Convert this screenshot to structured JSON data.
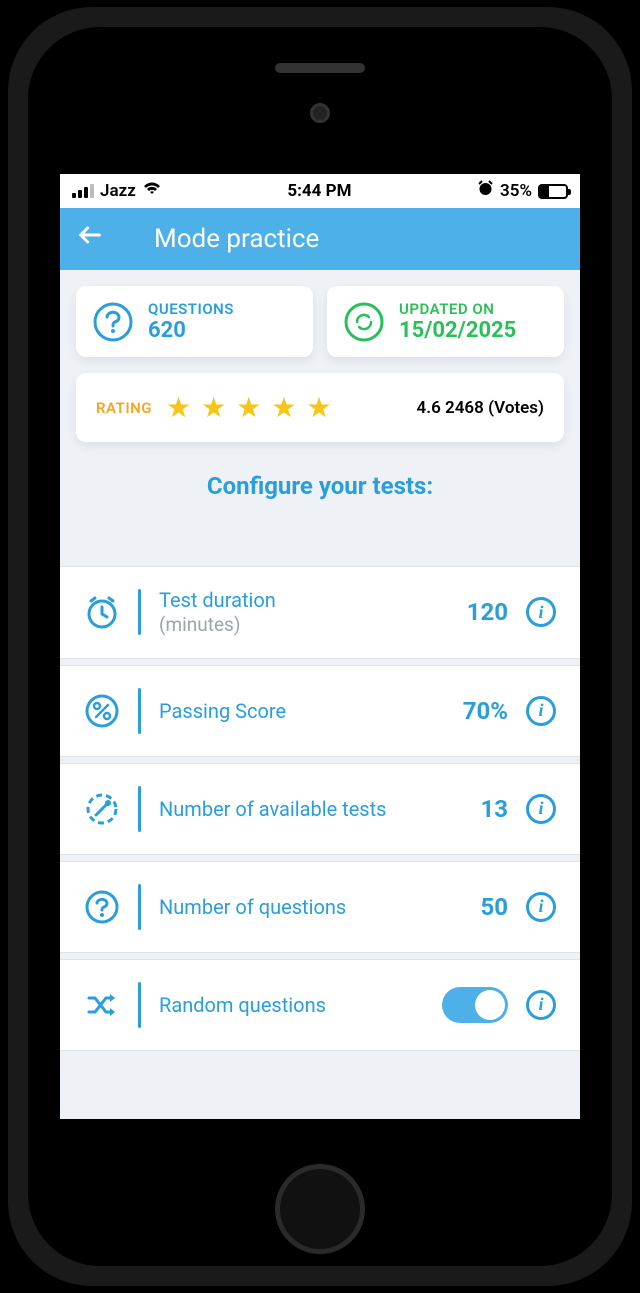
{
  "status": {
    "carrier": "Jazz",
    "time": "5:44 PM",
    "battery_pct": "35%"
  },
  "nav": {
    "title": "Mode practice"
  },
  "cards": {
    "questions": {
      "label": "QUESTIONS",
      "value": "620"
    },
    "updated": {
      "label": "UPDATED ON",
      "value": "15/02/2025"
    },
    "rating": {
      "label": "RATING",
      "votes_text": "4.6 2468 (Votes)"
    }
  },
  "configure_title": "Configure your tests:",
  "config": {
    "duration": {
      "label": "Test duration",
      "sublabel": "(minutes)",
      "value": "120"
    },
    "passing": {
      "label": "Passing Score",
      "value": "70%"
    },
    "tests": {
      "label": "Number of available tests",
      "value": "13"
    },
    "questions": {
      "label": "Number of questions",
      "value": "50"
    },
    "random": {
      "label": "Random questions",
      "on": true
    }
  }
}
